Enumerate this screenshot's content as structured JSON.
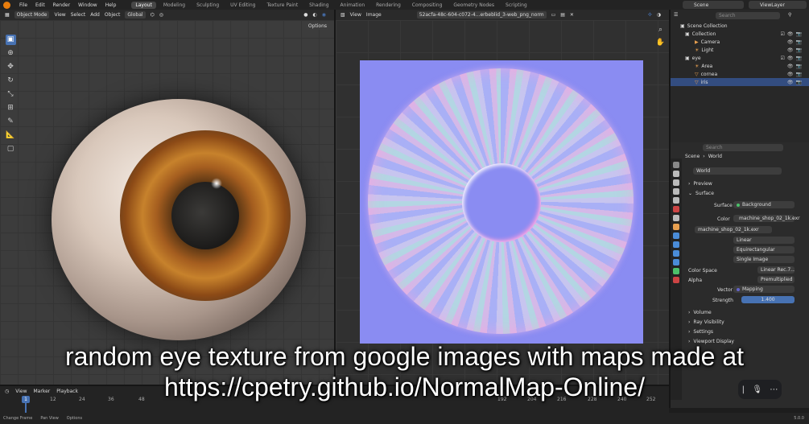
{
  "topbar": {
    "menus": [
      "File",
      "Edit",
      "Render",
      "Window",
      "Help"
    ],
    "workspaces": [
      "Layout",
      "Modeling",
      "Sculpting",
      "UV Editing",
      "Texture Paint",
      "Shading",
      "Animation",
      "Rendering",
      "Compositing",
      "Geometry Nodes",
      "Scripting"
    ],
    "active_workspace": "Layout",
    "scene": "Scene",
    "view_layer": "ViewLayer"
  },
  "viewport": {
    "mode": "Object Mode",
    "menus": [
      "View",
      "Select",
      "Add",
      "Object"
    ],
    "orientation": "Global",
    "options_label": "Options"
  },
  "image_editor": {
    "menus": [
      "View",
      "Image"
    ],
    "image_name": "52acfa-48c-604-c072-4...erbeblid_3-web_png_norm"
  },
  "outliner": {
    "search_placeholder": "Search",
    "rows": [
      {
        "label": "Scene Collection",
        "indent": 0
      },
      {
        "label": "Collection",
        "indent": 1
      },
      {
        "label": "Camera",
        "indent": 2
      },
      {
        "label": "Light",
        "indent": 2
      },
      {
        "label": "eye",
        "indent": 1
      },
      {
        "label": "Area",
        "indent": 2
      },
      {
        "label": "cornea",
        "indent": 2
      },
      {
        "label": "iris",
        "indent": 2
      }
    ],
    "selected_row": "iris"
  },
  "properties": {
    "search_placeholder": "Search",
    "breadcrumb_scene": "Scene",
    "breadcrumb_world": "World",
    "world_name": "World",
    "preview_label": "Preview",
    "surface_label": "Surface",
    "surface_field_label": "Surface",
    "surface_value": "Background",
    "color_label": "Color",
    "color_value": "machine_shop_02_1k.exr",
    "image_name": "machine_shop_02_1k.exr",
    "interpolation": "Linear",
    "projection": "Equirectangular",
    "source": "Single Image",
    "color_space_label": "Color Space",
    "color_space_value": "Linear Rec.7...",
    "alpha_label": "Alpha",
    "alpha_value": "Premultiplied",
    "vector_label": "Vector",
    "vector_value": "Mapping",
    "strength_label": "Strength",
    "strength_value": "1.400",
    "volume_label": "Volume",
    "ray_visibility_label": "Ray Visibility",
    "settings_label": "Settings",
    "viewport_display_label": "Viewport Display"
  },
  "timeline": {
    "menus": [
      "View",
      "Marker",
      "Playback"
    ],
    "current_frame": "1",
    "ticks": [
      "12",
      "24",
      "36",
      "48",
      "192",
      "204",
      "216",
      "228",
      "240",
      "252"
    ]
  },
  "statusbar": {
    "items": [
      "Change Frame",
      "Pan View",
      "Options"
    ],
    "version": "5.0.0"
  },
  "caption": {
    "line1": "random eye texture from google images with maps made at",
    "line2": "https://cpetry.github.io/NormalMap-Online/"
  },
  "colors": {
    "accent": "#4772b3",
    "selection": "#334d80",
    "logo": "#e87d0d",
    "normal_map_base": "#8a8cf2"
  }
}
